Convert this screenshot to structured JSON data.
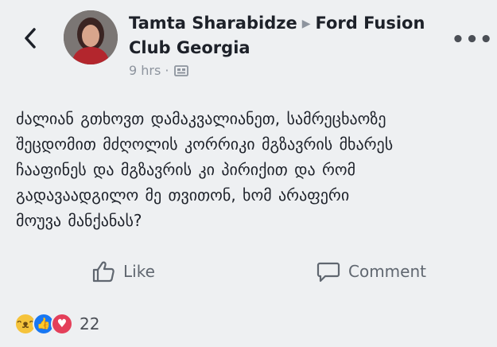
{
  "post": {
    "author": "Tamta Sharabidze",
    "group": "Ford Fusion",
    "group_line2": "Club Georgia",
    "time": "9 hrs ·",
    "text_lines": [
      "ძალიან გთხოვთ დამაკვალიანეთ, სამრეცხაოზე",
      "შეცდომით მძღოლის კორრიკი მგზავრის მხარეს",
      "ჩააფინეს და მგზავრის კი პირიქით და რომ",
      "გადავაადგილო მე თვითონ, ხომ არაფერი",
      "მოუვა მანქანას?"
    ]
  },
  "actions": {
    "like": "Like",
    "comment": "Comment"
  },
  "reactions": {
    "count": "22",
    "types": [
      "haha",
      "like",
      "love"
    ]
  },
  "icons": {
    "back": "chevron-left-icon",
    "more": "more-dots-icon",
    "privacy": "group-audience-icon",
    "like": "thumbs-up-icon",
    "comment": "comment-bubble-icon"
  },
  "colors": {
    "background": "#eef0f2",
    "text": "#1d2129",
    "muted": "#8d949e",
    "like_blue": "#1877f2",
    "love_red": "#e43f5a",
    "haha_yellow": "#f5c33b"
  }
}
